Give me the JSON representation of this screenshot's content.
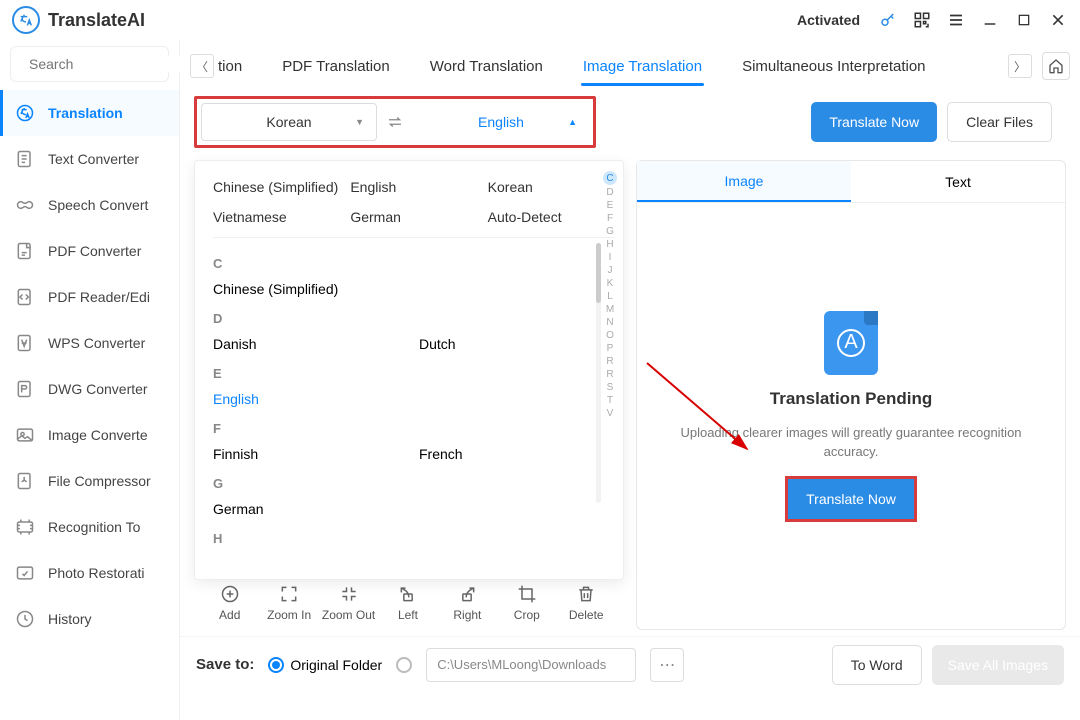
{
  "app": {
    "title": "TranslateAI",
    "activated": "Activated"
  },
  "search": {
    "placeholder": "Search"
  },
  "sidebar": {
    "items": [
      {
        "label": "Translation"
      },
      {
        "label": "Text Converter"
      },
      {
        "label": "Speech Convert"
      },
      {
        "label": "PDF Converter"
      },
      {
        "label": "PDF Reader/Edi"
      },
      {
        "label": "WPS Converter"
      },
      {
        "label": "DWG Converter"
      },
      {
        "label": "Image Converte"
      },
      {
        "label": "File Compressor"
      },
      {
        "label": "Recognition To"
      },
      {
        "label": "Photo Restorati"
      },
      {
        "label": "History"
      }
    ]
  },
  "tabs": {
    "partial": "tion",
    "items": [
      "PDF Translation",
      "Word Translation",
      "Image Translation",
      "Simultaneous Interpretation"
    ],
    "active_index": 2
  },
  "lang": {
    "source": "Korean",
    "target": "English",
    "translate_now": "Translate Now",
    "clear_files": "Clear Files"
  },
  "dropdown": {
    "recent": [
      [
        "Chinese (Simplified)",
        "English",
        "Korean"
      ],
      [
        "Vietnamese",
        "German",
        "Auto-Detect"
      ]
    ],
    "sections": [
      {
        "head": "C",
        "items": [
          "Chinese (Simplified)"
        ]
      },
      {
        "head": "D",
        "items": [
          "Danish",
          "Dutch"
        ]
      },
      {
        "head": "E",
        "items": [
          "English"
        ]
      },
      {
        "head": "F",
        "items": [
          "Finnish",
          "French"
        ]
      },
      {
        "head": "G",
        "items": [
          "German"
        ]
      },
      {
        "head": "H",
        "items": []
      }
    ],
    "selected": "English",
    "alpha": [
      "C",
      "D",
      "E",
      "F",
      "G",
      "H",
      "I",
      "J",
      "K",
      "L",
      "M",
      "N",
      "O",
      "P",
      "R",
      "R",
      "S",
      "T",
      "V"
    ],
    "alpha_current": "C"
  },
  "tools": [
    "Add",
    "Zoom In",
    "Zoom Out",
    "Left",
    "Right",
    "Crop",
    "Delete"
  ],
  "right_panel": {
    "tabs": [
      "Image",
      "Text"
    ],
    "active": 0,
    "pending_title": "Translation Pending",
    "pending_sub": "Uploading clearer images will greatly guarantee recognition accuracy.",
    "btn": "Translate Now"
  },
  "save": {
    "label": "Save to:",
    "original": "Original Folder",
    "path": "C:\\Users\\MLoong\\Downloads",
    "to_word": "To Word",
    "save_all": "Save All Images"
  }
}
